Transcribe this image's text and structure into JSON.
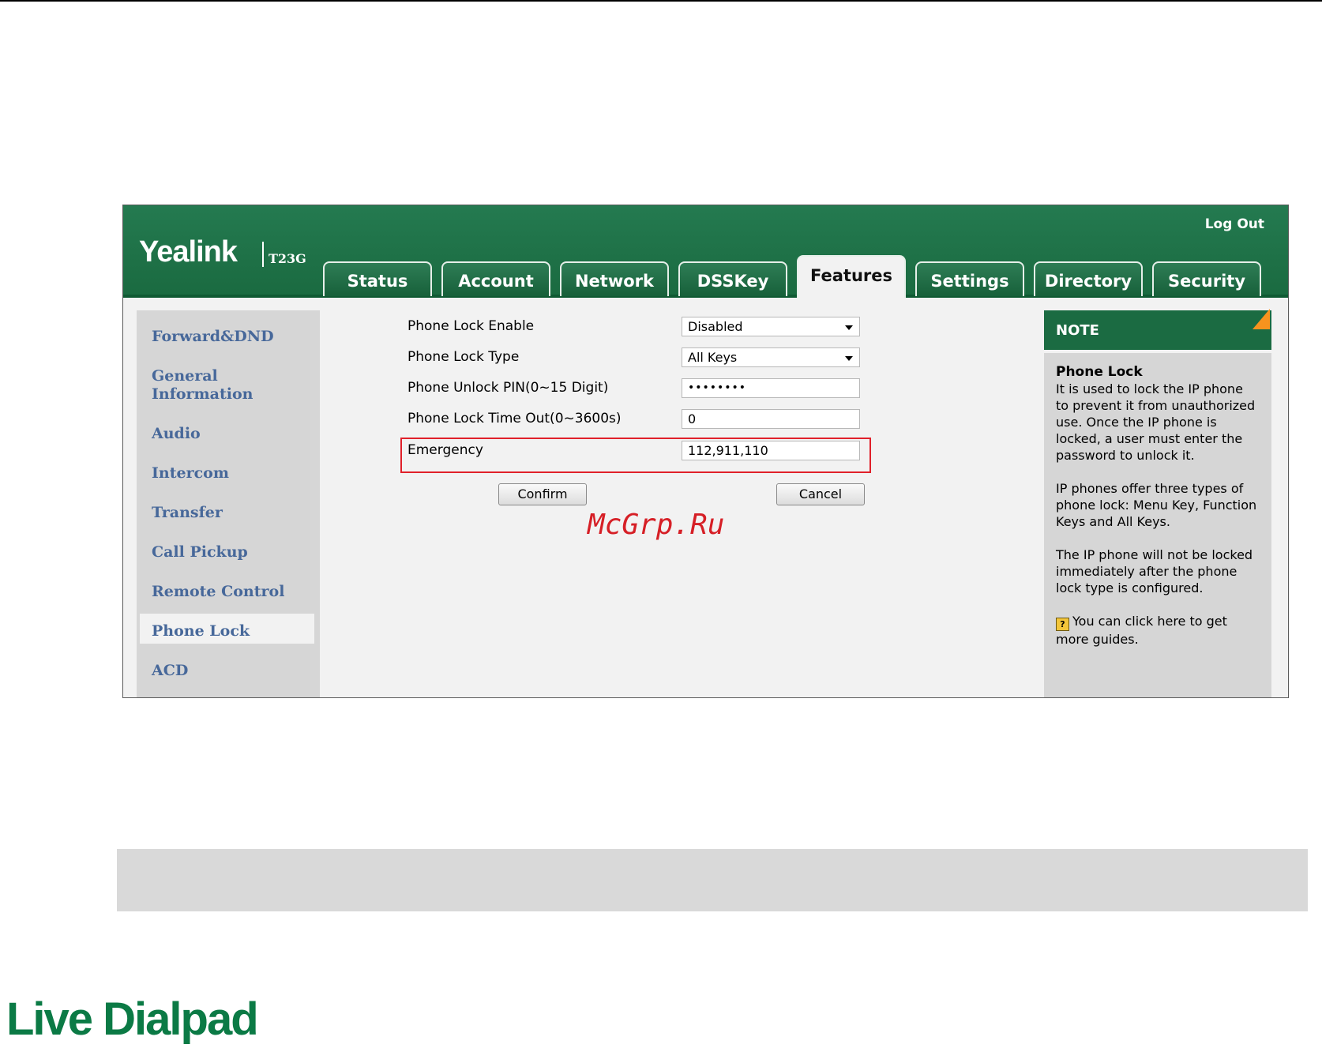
{
  "header": {
    "logo_text": "Yealink",
    "model": "T23G",
    "logout_label": "Log Out"
  },
  "tabs": [
    {
      "label": "Status"
    },
    {
      "label": "Account"
    },
    {
      "label": "Network"
    },
    {
      "label": "DSSKey"
    },
    {
      "label": "Features",
      "active": true
    },
    {
      "label": "Settings"
    },
    {
      "label": "Directory"
    },
    {
      "label": "Security"
    }
  ],
  "sidebar": {
    "items": [
      {
        "label": "Forward&DND"
      },
      {
        "label": "General Information"
      },
      {
        "label": "Audio"
      },
      {
        "label": "Intercom"
      },
      {
        "label": "Transfer"
      },
      {
        "label": "Call Pickup"
      },
      {
        "label": "Remote Control"
      },
      {
        "label": "Phone Lock",
        "active": true
      },
      {
        "label": "ACD"
      }
    ]
  },
  "form": {
    "phone_lock_enable": {
      "label": "Phone Lock Enable",
      "value": "Disabled"
    },
    "phone_lock_type": {
      "label": "Phone Lock Type",
      "value": "All Keys"
    },
    "unlock_pin": {
      "label": "Phone Unlock PIN(0~15 Digit)",
      "value": "••••••••"
    },
    "time_out": {
      "label": "Phone Lock Time Out(0~3600s)",
      "value": "0"
    },
    "emergency": {
      "label": "Emergency",
      "value": "112,911,110"
    },
    "confirm_label": "Confirm",
    "cancel_label": "Cancel"
  },
  "watermark": "McGrp.Ru",
  "note": {
    "heading": "NOTE",
    "title": "Phone Lock",
    "p1": "It is used to lock the IP phone to prevent it from unauthorized use. Once the IP phone is locked, a user must enter the password to unlock it.",
    "p2": "IP phones offer three types of phone lock: Menu Key, Function Keys and All Keys.",
    "p3": "The IP phone will not be locked immediately after the phone lock type is configured.",
    "guide_icon": "?",
    "guide": "You can click here to get more guides."
  },
  "footer_title": "Live Dialpad",
  "colors": {
    "header_green": "#1a6a40",
    "note_orange": "#f7931e",
    "sidebar_link": "#47689a",
    "highlight_red": "#e0202a",
    "footer_green": "#0b7a45"
  }
}
